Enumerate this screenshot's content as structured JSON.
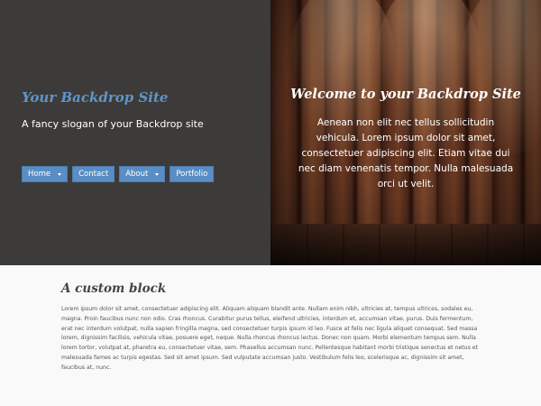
{
  "site": {
    "name": "Your Backdrop Site",
    "slogan": "A fancy slogan of your Backdrop site"
  },
  "nav": {
    "items": [
      {
        "label": "Home",
        "has_dropdown": true
      },
      {
        "label": "Contact",
        "has_dropdown": false
      },
      {
        "label": "About",
        "has_dropdown": true
      },
      {
        "label": "Portfolio",
        "has_dropdown": false
      }
    ]
  },
  "hero": {
    "heading": "Welcome to your Backdrop Site",
    "text": "Aenean non elit nec tellus sollicitudin vehicula. Lorem ipsum dolor sit amet, consectetuer adipiscing elit. Etiam vitae dui nec diam venenatis tempor. Nulla malesuada orci ut velit."
  },
  "custom_block": {
    "title": "A custom block",
    "body": "Lorem ipsum dolor sit amet, consectetuer adipiscing elit. Aliquam aliquam blandit ante. Nullam enim nibh, ultricies at, tempus ultrices, sodales eu, magna. Proin faucibus nunc non odio. Cras rhoncus. Curabitur purus tellus, eleifend ultricies, interdum et, accumsan vitae, purus. Duis fermentum, erat nec interdum volutpat, nulla sapien fringilla magna, sed consectetuer turpis ipsum id leo. Fusce at felis nec ligula aliquet consequat. Sed massa lorem, dignissim facilisis, vehicula vitae, posuere eget, neque. Nulla rhoncus rhoncus lectus. Donec non quam. Morbi elementum tempus sem. Nulla lorem tortor, volutpat at, pharetra eu, consectetuer vitae, sem. Phasellus accumsan nunc. Pellentesque habitant morbi tristique senectus et netus et malesuada fames ac turpis egestas. Sed sit amet ipsum. Sed vulputate accumsan justo. Vestibulum felis leo, scelerisque ac, dignissim sit amet, faucibus at, nunc."
  },
  "colors": {
    "left_panel_bg": "#3d3b39",
    "accent_blue": "#5a8dc4",
    "site_name": "#5f95c9"
  }
}
